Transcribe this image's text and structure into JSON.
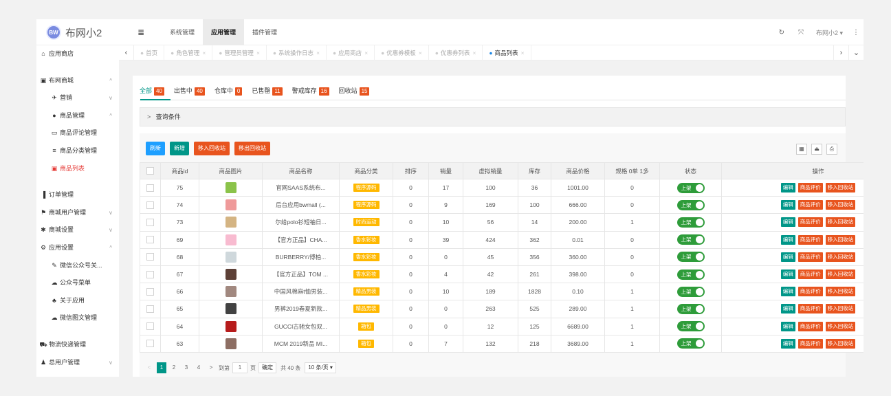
{
  "brand": {
    "logo_text": "布网小2",
    "logo_mark": "BW"
  },
  "topnav": {
    "toggle_icon": "≣",
    "items": [
      "系统管理",
      "应用管理",
      "插件管理"
    ],
    "active_index": 1
  },
  "topright": {
    "refresh_icon": "↻",
    "fullscreen_icon": "⤧",
    "user": "布网小2 ▾",
    "more_icon": "⋮"
  },
  "sidebar": {
    "items": [
      {
        "icon": "⌂",
        "label": "应用商店",
        "arrow": "",
        "sub": false
      },
      {
        "icon": "▣",
        "label": "布网商城",
        "arrow": "^",
        "sub": false
      },
      {
        "icon": "✈",
        "label": "营销",
        "arrow": "v",
        "sub": true
      },
      {
        "icon": "●",
        "label": "商品管理",
        "arrow": "^",
        "sub": true
      },
      {
        "icon": "▭",
        "label": "商品评论管理",
        "arrow": "",
        "sub": true
      },
      {
        "icon": "≡",
        "label": "商品分类管理",
        "arrow": "",
        "sub": true
      },
      {
        "icon": "▣",
        "label": "商品列表",
        "arrow": "",
        "sub": true,
        "active": true
      },
      {
        "icon": "▐",
        "label": "订单管理",
        "arrow": "",
        "sub": false
      },
      {
        "icon": "⚑",
        "label": "商城用户管理",
        "arrow": "v",
        "sub": false
      },
      {
        "icon": "✱",
        "label": "商城设置",
        "arrow": "v",
        "sub": false
      },
      {
        "icon": "⚙",
        "label": "应用设置",
        "arrow": "^",
        "sub": false
      },
      {
        "icon": "✎",
        "label": "微信公众号关...",
        "arrow": "",
        "sub": true
      },
      {
        "icon": "☁",
        "label": "公众号菜单",
        "arrow": "",
        "sub": true
      },
      {
        "icon": "♣",
        "label": "关于应用",
        "arrow": "",
        "sub": true
      },
      {
        "icon": "☁",
        "label": "微信图文管理",
        "arrow": "",
        "sub": true
      },
      {
        "icon": "⛟",
        "label": "物流快递管理",
        "arrow": "",
        "sub": false
      },
      {
        "icon": "♟",
        "label": "总用户管理",
        "arrow": "v",
        "sub": false
      }
    ]
  },
  "tabbar": {
    "left_icon": "‹",
    "right_icon": "›",
    "down_icon": "⌄",
    "tabs": [
      "首页",
      "角色管理",
      "管理员管理",
      "系统操作日志",
      "应用商店",
      "优惠券模板",
      "优惠券列表",
      "商品列表"
    ],
    "active_index": 7
  },
  "filter_tabs": [
    {
      "label": "全部",
      "count": "40"
    },
    {
      "label": "出售中",
      "count": "40"
    },
    {
      "label": "仓库中",
      "count": "0"
    },
    {
      "label": "已售罄",
      "count": "11"
    },
    {
      "label": "警戒库存",
      "count": "16"
    },
    {
      "label": "回收站",
      "count": "15"
    }
  ],
  "query": {
    "chevron": ">",
    "label": "查询条件"
  },
  "toolbar": {
    "refresh": "刷新",
    "add": "新增",
    "move_in": "移入回收站",
    "move_out": "移出回收站",
    "icons": [
      "▦",
      "⏏",
      "⎙"
    ]
  },
  "table": {
    "headers": [
      "",
      "商品id",
      "商品图片",
      "商品名称",
      "商品分类",
      "排序",
      "销量",
      "虚拟销量",
      "库存",
      "商品价格",
      "规格 0单 1多",
      "状态",
      "操作"
    ],
    "rows": [
      {
        "id": "75",
        "img": "#8bc34a",
        "name": "官网SAAS系统布...",
        "cat": "程序源码",
        "sort": "0",
        "sales": "17",
        "vsales": "100",
        "stock": "36",
        "price": "1001.00",
        "spec": "0"
      },
      {
        "id": "74",
        "img": "#ef9a9a",
        "name": "后台应用bwmall (...",
        "cat": "程序源码",
        "sort": "0",
        "sales": "9",
        "vsales": "169",
        "stock": "100",
        "price": "666.00",
        "spec": "0"
      },
      {
        "id": "73",
        "img": "#d4b483",
        "name": "尔给polo衫短袖日...",
        "cat": "时尚运动",
        "sort": "0",
        "sales": "10",
        "vsales": "56",
        "stock": "14",
        "price": "200.00",
        "spec": "1"
      },
      {
        "id": "69",
        "img": "#f8bbd0",
        "name": "【官方正品】CHA...",
        "cat": "香水彩妆",
        "sort": "0",
        "sales": "39",
        "vsales": "424",
        "stock": "362",
        "price": "0.01",
        "spec": "0"
      },
      {
        "id": "68",
        "img": "#cfd8dc",
        "name": "BURBERRY/博柏...",
        "cat": "香水彩妆",
        "sort": "0",
        "sales": "0",
        "vsales": "45",
        "stock": "356",
        "price": "360.00",
        "spec": "0"
      },
      {
        "id": "67",
        "img": "#5d4037",
        "name": "【官方正品】TOM ...",
        "cat": "香水彩妆",
        "sort": "0",
        "sales": "4",
        "vsales": "42",
        "stock": "261",
        "price": "398.00",
        "spec": "0"
      },
      {
        "id": "66",
        "img": "#a1887f",
        "name": "中国风棉麻t恤男装...",
        "cat": "精品男装",
        "sort": "0",
        "sales": "10",
        "vsales": "189",
        "stock": "1828",
        "price": "0.10",
        "spec": "1"
      },
      {
        "id": "65",
        "img": "#424242",
        "name": "男裤2019春夏新款...",
        "cat": "精品男装",
        "sort": "0",
        "sales": "0",
        "vsales": "263",
        "stock": "525",
        "price": "289.00",
        "spec": "1"
      },
      {
        "id": "64",
        "img": "#b71c1c",
        "name": "GUCCI古驰女包双...",
        "cat": "箱包",
        "sort": "0",
        "sales": "0",
        "vsales": "12",
        "stock": "125",
        "price": "6689.00",
        "spec": "1"
      },
      {
        "id": "63",
        "img": "#8d6e63",
        "name": "MCM 2019新品 MI...",
        "cat": "箱包",
        "sort": "0",
        "sales": "7",
        "vsales": "132",
        "stock": "218",
        "price": "3689.00",
        "spec": "1"
      }
    ],
    "status_label": "上架",
    "ops": [
      "编辑",
      "商品评价",
      "移入回收站"
    ]
  },
  "pager": {
    "prev": "<",
    "pages": [
      "1",
      "2",
      "3",
      "4"
    ],
    "current": "1",
    "next": ">",
    "goto_label": "到第",
    "goto_value": "1",
    "page_unit": "页",
    "confirm": "确定",
    "total": "共 40 条",
    "per_page": "10 条/页 ▾"
  }
}
